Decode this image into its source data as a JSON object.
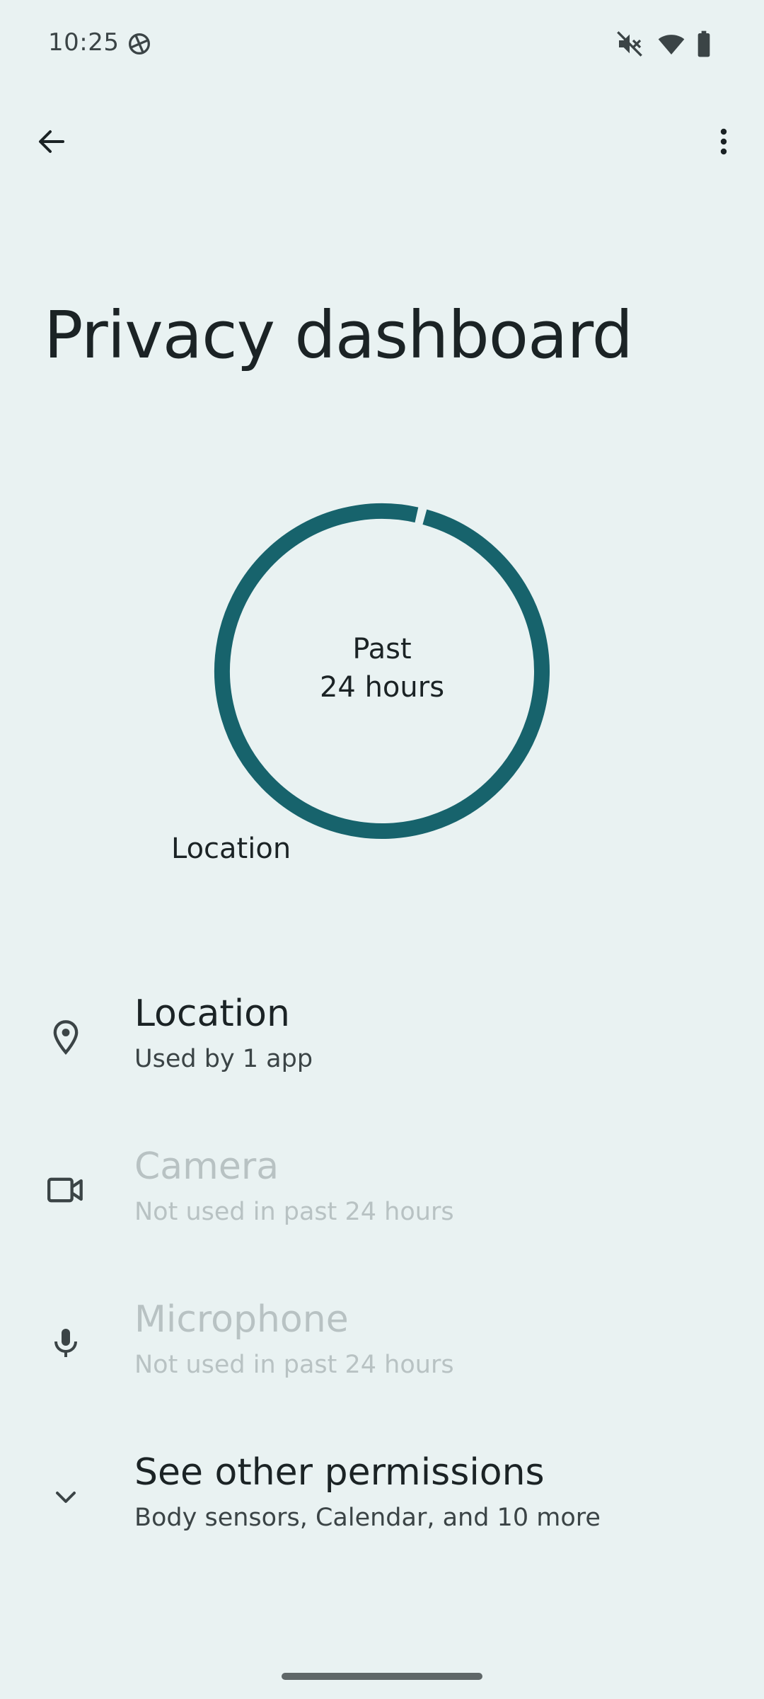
{
  "status_bar": {
    "time": "10:25",
    "icons": [
      "satellite-icon",
      "mute-icon",
      "wifi-icon",
      "battery-icon"
    ]
  },
  "toolbar": {
    "back_icon": "arrow-left-icon",
    "menu_icon": "more-vert-icon"
  },
  "page": {
    "title": "Privacy dashboard"
  },
  "chart_data": {
    "type": "pie",
    "center_line1": "Past",
    "center_line2": "24 hours",
    "series": [
      {
        "name": "Location",
        "value": 1
      }
    ],
    "accent_color": "#17636c"
  },
  "permissions": [
    {
      "title": "Location",
      "subtitle": "Used by 1 app",
      "icon": "location-pin-icon",
      "enabled": true
    },
    {
      "title": "Camera",
      "subtitle": "Not used in past 24 hours",
      "icon": "videocam-icon",
      "enabled": false
    },
    {
      "title": "Microphone",
      "subtitle": "Not used in past 24 hours",
      "icon": "microphone-icon",
      "enabled": false
    },
    {
      "title": "See other permissions",
      "subtitle": "Body sensors, Calendar, and 10 more",
      "icon": "chevron-down-icon",
      "enabled": true
    }
  ],
  "colors": {
    "background": "#e9f2f2",
    "ring": "#17636c",
    "text_primary": "#1b2325",
    "text_disabled": "#b8c2c3"
  }
}
